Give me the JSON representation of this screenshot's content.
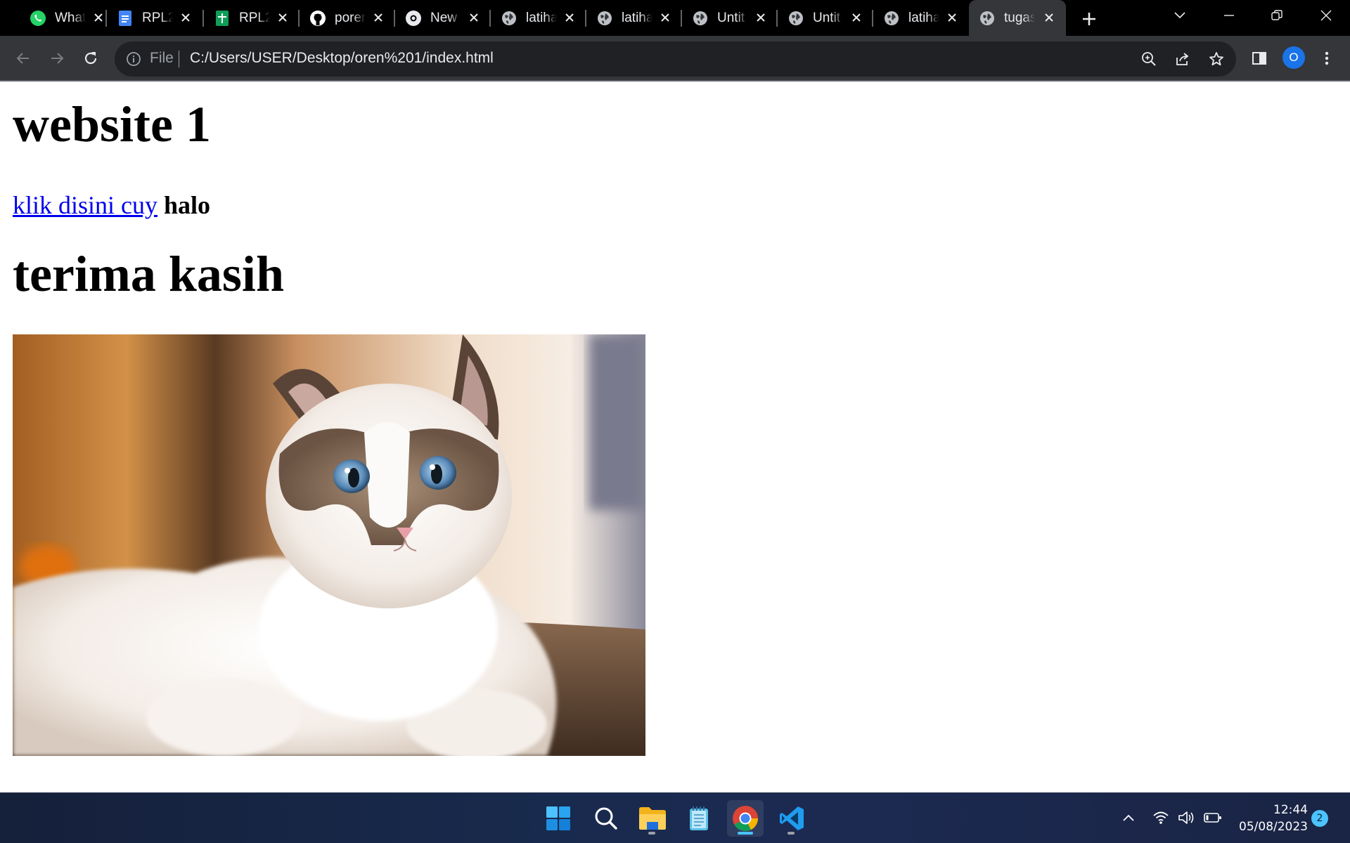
{
  "browser": {
    "tabs": [
      {
        "title": "What",
        "icon": "whatsapp-icon",
        "active": false
      },
      {
        "title": "RPL2",
        "icon": "google-docs-icon",
        "active": false
      },
      {
        "title": "RPL2",
        "icon": "google-sheets-icon",
        "active": false
      },
      {
        "title": "porer",
        "icon": "github-icon",
        "active": false
      },
      {
        "title": "New",
        "icon": "chrome-icon",
        "active": false
      },
      {
        "title": "latiha",
        "icon": "globe-icon",
        "active": false
      },
      {
        "title": "latiha",
        "icon": "globe-icon",
        "active": false
      },
      {
        "title": "Untit",
        "icon": "globe-icon",
        "active": false
      },
      {
        "title": "Untit",
        "icon": "globe-icon",
        "active": false
      },
      {
        "title": "latiha",
        "icon": "globe-icon",
        "active": false
      },
      {
        "title": "tugas",
        "icon": "globe-icon",
        "active": true
      }
    ],
    "address": {
      "scheme_label": "File",
      "url": "C:/Users/USER/Desktop/oren%201/index.html"
    },
    "profile_initial": "O"
  },
  "page": {
    "heading1": "website 1",
    "link_text": "klik disini cuy",
    "bold_text": "halo",
    "heading2": "terima kasih",
    "image_subject": "ragdoll cat lying on wooden floor"
  },
  "taskbar": {
    "apps": [
      "windows-start-icon",
      "search-icon",
      "file-explorer-icon",
      "notepad-icon",
      "chrome-icon",
      "vscode-icon"
    ],
    "time": "12:44",
    "date": "05/08/2023",
    "notifications": "2"
  },
  "colors": {
    "tabstrip": "#000000",
    "toolbar": "#35363a",
    "omnibox": "#202124",
    "link": "#0000ee",
    "accent": "#1a73e8",
    "taskbar_indicator": "#4cc2ff"
  }
}
